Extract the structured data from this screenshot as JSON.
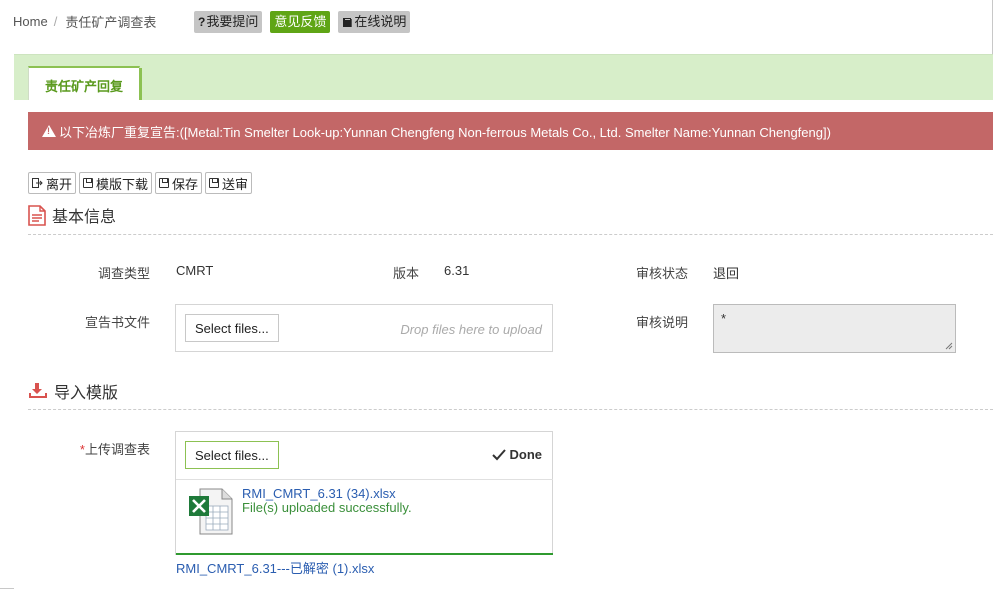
{
  "breadcrumb": {
    "home": "Home",
    "separator": "/",
    "current": "责任矿产调查表"
  },
  "top_buttons": [
    {
      "icon": "?",
      "label": "我要提问",
      "style": "gray"
    },
    {
      "icon": "",
      "label": "意见反馈",
      "style": "green"
    },
    {
      "icon": "book-icon",
      "label": "在线说明",
      "style": "gray"
    }
  ],
  "tab": {
    "label": "责任矿产回复"
  },
  "alert": {
    "text": "以下冶炼厂重复宣告:([Metal:Tin Smelter Look-up:Yunnan Chengfeng Non-ferrous Metals Co., Ltd. Smelter Name:Yunnan Chengfeng])"
  },
  "actions": [
    {
      "label": "离开",
      "icon": "exit-icon"
    },
    {
      "label": "模版下载",
      "icon": "disk-icon"
    },
    {
      "label": "保存",
      "icon": "disk-icon"
    },
    {
      "label": "送审",
      "icon": "disk-icon"
    }
  ],
  "basic_info": {
    "title": "基本信息",
    "survey_type_label": "调查类型",
    "survey_type_value": "CMRT",
    "version_label": "版本",
    "version_value": "6.31",
    "review_status_label": "审核状态",
    "review_status_value": "退回",
    "declaration_file_label": "宣告书文件",
    "select_files": "Select files...",
    "drop_hint": "Drop files here to upload",
    "review_note_label": "审核说明",
    "review_note_value": "*"
  },
  "import_template": {
    "title": "导入模版",
    "required_mark": "*",
    "upload_label": "上传调查表",
    "select_files": "Select files...",
    "done_label": "Done",
    "uploaded_file_name": "RMI_CMRT_6.31 (34).xlsx",
    "uploaded_status": "File(s) uploaded successfully.",
    "file_link": "RMI_CMRT_6.31---已解密 (1).xlsx"
  },
  "colors": {
    "accent_green": "#5fa515",
    "alert_red": "#c36767",
    "panel_head": "#d7eec9"
  }
}
